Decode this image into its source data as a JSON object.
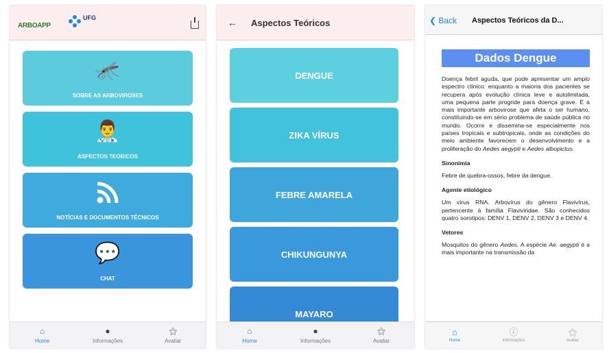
{
  "screen1": {
    "logo_left": "ARBOAPP",
    "logo_ufg": "UFG",
    "tiles": [
      {
        "label": "SOBRE AS ARBOVIROSES",
        "color": "#5ccbdd",
        "icon": "mosquito-icon",
        "glyph": "🦟"
      },
      {
        "label": "ASPECTOS TEORICOS",
        "color": "#3fc3dd",
        "icon": "doctor-icon",
        "glyph": "👨‍⚕️"
      },
      {
        "label": "NOTÍCIAS E DOCUMENTOS TÉCNICOS",
        "color": "#3eaadd",
        "icon": "rss-icon",
        "glyph": "⟟"
      },
      {
        "label": "CHAT",
        "color": "#3a95dc",
        "icon": "chat-icon",
        "glyph": "💬"
      }
    ],
    "nav": [
      {
        "label": "Home",
        "icon": "home-icon",
        "glyph": "⌂",
        "active": true
      },
      {
        "label": "Informações",
        "icon": "info-icon",
        "glyph": "●",
        "active": false
      },
      {
        "label": "Avaliar",
        "icon": "rate-icon",
        "glyph": "⚝",
        "active": false
      }
    ]
  },
  "screen2": {
    "back_glyph": "←",
    "title": "Aspectos Teóricos",
    "buttons": [
      {
        "label": "DENGUE",
        "color": "#5dd0e0"
      },
      {
        "label": "ZIKA VÍRUS",
        "color": "#42c2dc"
      },
      {
        "label": "FEBRE AMARELA",
        "color": "#3fa6dc"
      },
      {
        "label": "CHIKUNGUNYA",
        "color": "#3a98dc"
      },
      {
        "label": "MAYARO",
        "color": "#358ad6"
      }
    ],
    "nav": [
      {
        "label": "Home",
        "icon": "home-icon",
        "glyph": "⌂",
        "active": true
      },
      {
        "label": "Informações",
        "icon": "info-icon",
        "glyph": "●",
        "active": false
      },
      {
        "label": "Avaliar",
        "icon": "rate-icon",
        "glyph": "⚝",
        "active": false
      }
    ]
  },
  "screen3": {
    "back_label": "Back",
    "title": "Aspectos Teóricos da D...",
    "banner": "Dados Dengue",
    "intro_parts": [
      "Doença febril aguda, que pode apresentar um amplo espectro clínico: enquanto a maioria dos pacientes se recupera após evolução clínica leve e autolimitada, uma pequena parte progride para doença grave. É a mais importante arbovirose que afeta o ser humano, constituindo-se em sério problema de saúde pública no mundo. Ocorre e dissemina-se especialmente nos países tropicais e subtropicais, onde as condições do meio ambiente favorecem o desenvolvimento e a proliferação do ",
      "Aedes aegypti",
      " e ",
      "Aedes albopictus",
      "."
    ],
    "sinonimia_title": "Sinonimia",
    "sinonimia_text": "Febre de quebra-ossos, febre da dengue.",
    "agente_title": "Agente etiológico",
    "agente_text": "Um vírus RNA. Arbovírus do gênero Flavivírus, pertencente à família Flaviviridae. São conhecidos quatro sorotipos: DENV 1, DENV 2, DENV 3 e DENV 4.",
    "vetores_title": "Vetores",
    "vetores_parts": [
      "Mosquitos do gênero ",
      "Aedes",
      ". A espécie ",
      "Ae. aegypti",
      " é a mais importante na transmissão da"
    ],
    "nav": [
      {
        "label": "Home",
        "icon": "home-icon",
        "glyph": "⌂",
        "active": true
      },
      {
        "label": "Informações",
        "icon": "info-icon",
        "glyph": "ⓘ",
        "active": false
      },
      {
        "label": "Avaliar",
        "icon": "rate-icon",
        "glyph": "⚝",
        "active": false
      }
    ]
  }
}
